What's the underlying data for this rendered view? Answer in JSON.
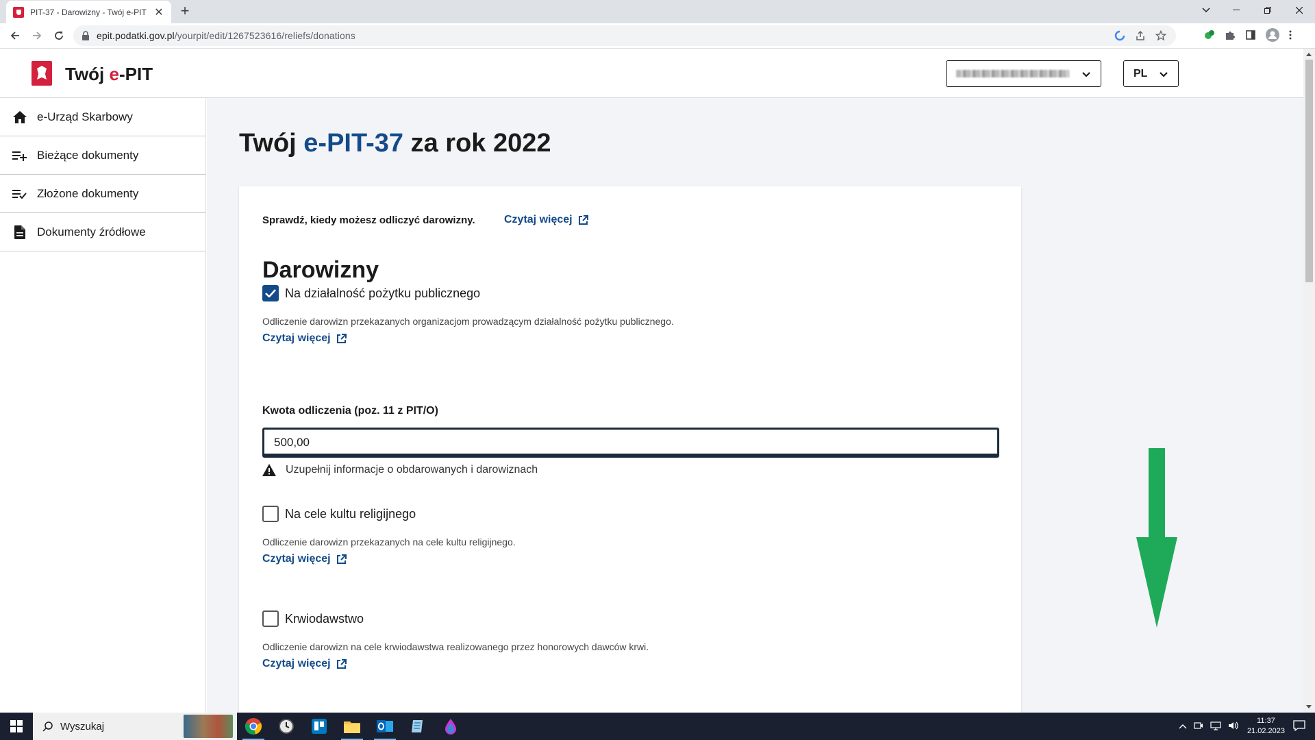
{
  "browser": {
    "tab_title": "PIT-37 - Darowizny - Twój e-PIT",
    "url_host": "epit.podatki.gov.pl",
    "url_path": "/yourpit/edit/1267523616/reliefs/donations"
  },
  "header": {
    "logo_prefix": "Twój ",
    "logo_e": "e",
    "logo_suffix": "-PIT",
    "language": "PL"
  },
  "sidebar": {
    "items": [
      {
        "label": "e-Urząd Skarbowy",
        "icon": "home-icon"
      },
      {
        "label": "Bieżące dokumenty",
        "icon": "playlist-add-icon"
      },
      {
        "label": "Złożone dokumenty",
        "icon": "playlist-check-icon"
      },
      {
        "label": "Dokumenty źródłowe",
        "icon": "document-icon"
      }
    ]
  },
  "main": {
    "title_a": "Twój ",
    "title_b": "e-PIT-",
    "title_c": "37",
    "title_d": " za rok 2022",
    "hint": "Sprawdź, kiedy możesz odliczyć darowizny.",
    "hint_link": "Czytaj więcej",
    "section_title": "Darowizny",
    "options": [
      {
        "label": "Na działalność pożytku publicznego",
        "checked": true,
        "desc": "Odliczenie darowizn przekazanych organizacjom prowadzącym działalność pożytku publicznego.",
        "link": "Czytaj więcej"
      },
      {
        "label": "Na cele kultu religijnego",
        "checked": false,
        "desc": "Odliczenie darowizn przekazanych na cele kultu religijnego.",
        "link": "Czytaj więcej"
      },
      {
        "label": "Krwiodawstwo",
        "checked": false,
        "desc": "Odliczenie darowizn na cele krwiodawstwa realizowanego przez honorowych dawców krwi.",
        "link": "Czytaj więcej"
      }
    ],
    "amount_label": "Kwota odliczenia (poz. 11 z PIT/O)",
    "amount_value": "500,00",
    "warning": "Uzupełnij informacje o obdarowanych i darowiznach"
  },
  "taskbar": {
    "search": "Wyszukaj",
    "time": "11:37",
    "date": "21.02.2023"
  },
  "colors": {
    "brand_blue": "#134b8a",
    "brand_red": "#d4213d",
    "arrow_green": "#1faa59"
  }
}
